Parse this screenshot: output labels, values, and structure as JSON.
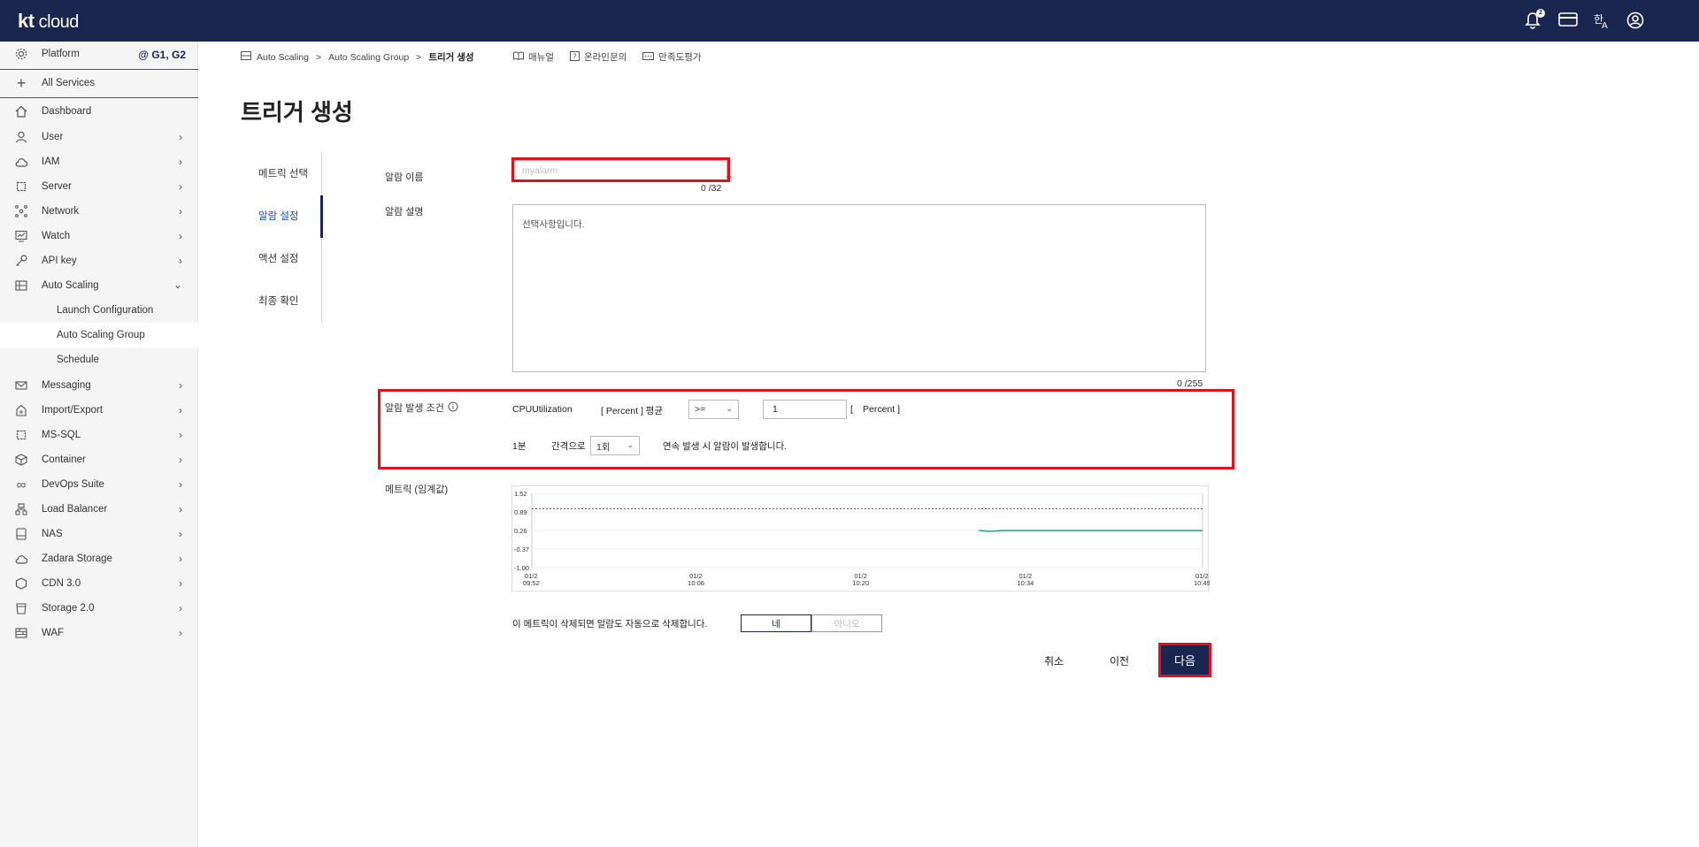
{
  "brand": {
    "logo_bold": "kt",
    "logo_rest": " cloud"
  },
  "topbar": {
    "notification_count": "2"
  },
  "sidebar": {
    "platform_label": "Platform",
    "region": "@ G1, G2",
    "all_services": "All Services",
    "items": [
      {
        "label": "Dashboard"
      },
      {
        "label": "User"
      },
      {
        "label": "IAM"
      },
      {
        "label": "Server"
      },
      {
        "label": "Network"
      },
      {
        "label": "Watch"
      },
      {
        "label": "API key"
      },
      {
        "label": "Auto Scaling"
      }
    ],
    "sub_items": [
      {
        "label": "Launch Configuration"
      },
      {
        "label": "Auto Scaling Group"
      },
      {
        "label": "Schedule"
      }
    ],
    "items_after": [
      {
        "label": "Messaging"
      },
      {
        "label": "Import/Export"
      },
      {
        "label": "MS-SQL"
      },
      {
        "label": "Container"
      },
      {
        "label": "DevOps Suite"
      },
      {
        "label": "Load Balancer"
      },
      {
        "label": "NAS"
      },
      {
        "label": "Zadara Storage"
      },
      {
        "label": "CDN 3.0"
      },
      {
        "label": "Storage 2.0"
      },
      {
        "label": "WAF"
      }
    ]
  },
  "breadcrumb": {
    "items": [
      "Auto Scaling",
      "Auto Scaling Group",
      "트리거 생성"
    ],
    "separator": ">",
    "links": [
      "매뉴얼",
      "온라인문의",
      "만족도평가"
    ]
  },
  "page": {
    "title": "트리거 생성"
  },
  "steps": [
    "메트릭 선택",
    "알람 설정",
    "액션 설정",
    "최종 확인"
  ],
  "form": {
    "alarm_name_label": "알람 이름",
    "alarm_name_placeholder": "myalarm",
    "alarm_name_counter": "0 /32",
    "alarm_desc_label": "알람 설명",
    "alarm_desc_placeholder": "선택사항입니다.",
    "alarm_desc_counter": "0 /255",
    "condition_label": "알람 발생 조건",
    "metric_name": "CPUUtilization",
    "unit_avg": "[ Percent ] 평균",
    "operator": ">=",
    "threshold": "1",
    "unit_open": "[",
    "unit": "Percent ]",
    "period": "1분",
    "interval_label": "간격으로",
    "count": "1회",
    "consecutive_text": "연속 발생 시 알람이 발생합니다.",
    "metric_chart_label": "메트릭 (임계값)",
    "delete_text": "이 메트릭이 삭제되면 알람도 자동으로 삭제합니다.",
    "yes": "네",
    "no": "아니오"
  },
  "buttons": {
    "cancel": "취소",
    "prev": "이전",
    "next": "다음"
  },
  "chart_data": {
    "type": "line",
    "y_ticks": [
      "1.52",
      "0.89",
      "0.26",
      "-0.37",
      "-1.00"
    ],
    "ylim": [
      -1.0,
      1.52
    ],
    "x_ticks": [
      {
        "date": "01/2",
        "time": "09:52"
      },
      {
        "date": "01/2",
        "time": "10:06"
      },
      {
        "date": "01/2",
        "time": "10:20"
      },
      {
        "date": "01/2",
        "time": "10:34"
      },
      {
        "date": "01/2",
        "time": "10:49"
      }
    ],
    "threshold": 1.0,
    "threshold_color": "#e0101c",
    "series": [
      {
        "color": "#1aa88a",
        "points": [
          {
            "x": "10:30",
            "y": 0.26
          },
          {
            "x": "10:31",
            "y": 0.23
          },
          {
            "x": "10:32",
            "y": 0.26
          },
          {
            "x": "10:49",
            "y": 0.26
          }
        ]
      }
    ],
    "grid": true
  }
}
